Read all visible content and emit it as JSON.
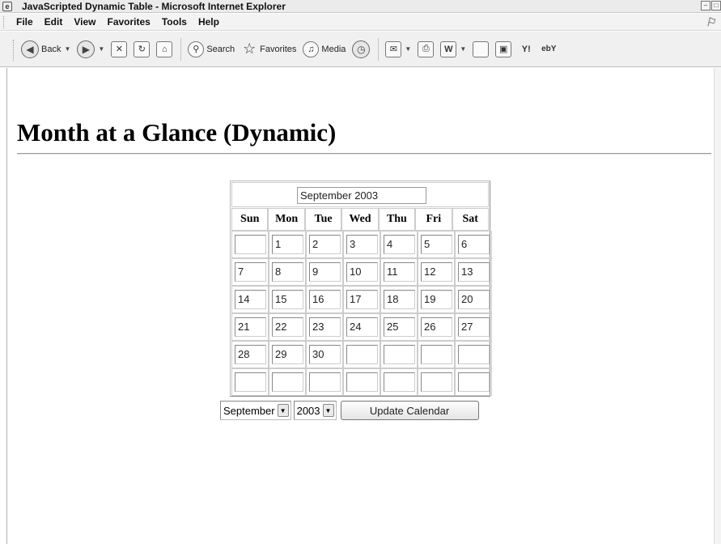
{
  "window": {
    "title": "JavaScripted Dynamic Table - Microsoft Internet Explorer"
  },
  "menu": [
    "File",
    "Edit",
    "View",
    "Favorites",
    "Tools",
    "Help"
  ],
  "toolbar": {
    "back_label": "Back",
    "search_label": "Search",
    "favorites_label": "Favorites",
    "media_label": "Media"
  },
  "page": {
    "heading": "Month at a Glance (Dynamic)"
  },
  "calendar": {
    "month_title": "September 2003",
    "days_of_week": [
      "Sun",
      "Mon",
      "Tue",
      "Wed",
      "Thu",
      "Fri",
      "Sat"
    ],
    "weeks": [
      [
        "",
        "1",
        "2",
        "3",
        "4",
        "5",
        "6"
      ],
      [
        "7",
        "8",
        "9",
        "10",
        "11",
        "12",
        "13"
      ],
      [
        "14",
        "15",
        "16",
        "17",
        "18",
        "19",
        "20"
      ],
      [
        "21",
        "22",
        "23",
        "24",
        "25",
        "26",
        "27"
      ],
      [
        "28",
        "29",
        "30",
        "",
        "",
        "",
        ""
      ],
      [
        "",
        "",
        "",
        "",
        "",
        "",
        ""
      ]
    ]
  },
  "controls": {
    "month_select": "September",
    "year_select": "2003",
    "update_button": "Update Calendar"
  }
}
